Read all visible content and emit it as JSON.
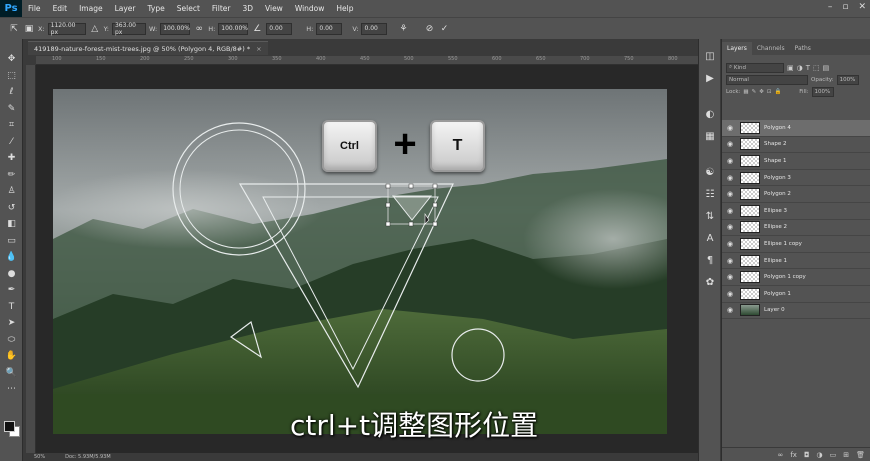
{
  "app": {
    "logo": "Ps"
  },
  "menu": [
    "File",
    "Edit",
    "Image",
    "Layer",
    "Type",
    "Select",
    "Filter",
    "3D",
    "View",
    "Window",
    "Help"
  ],
  "options_bar": {
    "x_label": "X:",
    "x_value": "1120.00 px",
    "y_label": "Y:",
    "y_value": "363.00 px",
    "w_label": "W:",
    "w_value": "100.00%",
    "h_label": "H:",
    "h_value": "100.00%",
    "angle_value": "0.00",
    "hskew_label": "H:",
    "hskew_value": "0.00",
    "vskew_label": "V:",
    "vskew_value": "0.00"
  },
  "document": {
    "tab_title": "419189-nature-forest-mist-trees.jpg @ 50% (Polygon 4, RGB/8#) *",
    "tab_close": "×",
    "status_zoom": "50%",
    "status_doc": "Doc: 5.93M/5.93M"
  },
  "ruler_top_ticks": [
    "100",
    "150",
    "200",
    "250",
    "300",
    "350",
    "400",
    "450",
    "500",
    "550",
    "600",
    "650",
    "700",
    "750",
    "800"
  ],
  "overlay": {
    "key_ctrl": "Ctrl",
    "key_plus": "+",
    "key_t": "T",
    "caption": "ctrl+t调整图形位置"
  },
  "panel": {
    "tabs": [
      "Layers",
      "Channels",
      "Paths"
    ],
    "active_tab": "Layers",
    "filter_placeholder": "Kind",
    "blend_mode": "Normal",
    "opacity_label": "Opacity:",
    "opacity_value": "100%",
    "lock_label": "Lock:",
    "fill_label": "Fill:",
    "fill_value": "100%",
    "layers": [
      {
        "name": "Polygon 4",
        "selected": true
      },
      {
        "name": "Shape 2"
      },
      {
        "name": "Shape 1"
      },
      {
        "name": "Polygon 3"
      },
      {
        "name": "Polygon 2"
      },
      {
        "name": "Ellipse 3"
      },
      {
        "name": "Ellipse 2"
      },
      {
        "name": "Ellipse 1 copy"
      },
      {
        "name": "Ellipse 1"
      },
      {
        "name": "Polygon 1 copy"
      },
      {
        "name": "Polygon 1"
      },
      {
        "name": "Layer 0",
        "photo": true
      }
    ]
  }
}
